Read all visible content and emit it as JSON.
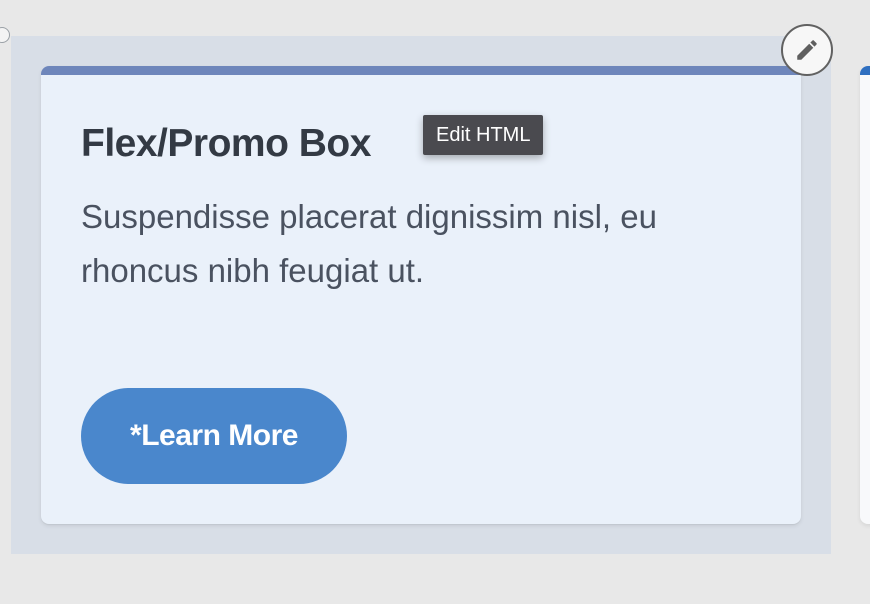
{
  "promo_box": {
    "title": "Flex/Promo Box",
    "body": "Suspendisse placerat dignissim nisl, eu rhoncus nibh feugiat ut.",
    "button_label": "*Learn More"
  },
  "tooltip": {
    "text": "Edit HTML"
  },
  "edit_button": {
    "icon": "pencil-icon"
  },
  "colors": {
    "page_background": "#e8e8e8",
    "selection_background": "#d8dee7",
    "card_background": "#eaf1fa",
    "card_accent": "#6e86bb",
    "button_background": "#4a87cc",
    "title_text": "#333a44",
    "body_text": "#4a5260",
    "tooltip_background": "#4a4a4f",
    "next_card_accent": "#2f6fc0"
  }
}
